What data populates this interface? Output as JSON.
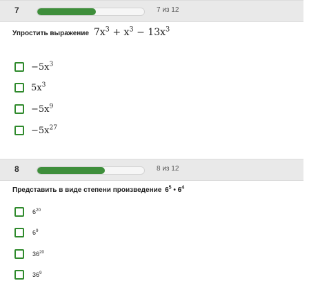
{
  "colors": {
    "accent": "#3e8e3b",
    "header_bg": "#e9e9e9",
    "checkbox_border": "#2f8a2c"
  },
  "questions": [
    {
      "number": "7",
      "progress": 0.55,
      "counter": "7 из 12",
      "prompt": "Упростить выражение",
      "expression": {
        "a": "7x",
        "a_exp": "3",
        "plus": "+",
        "b": "x",
        "b_exp": "3",
        "minus": "−",
        "c": "13x",
        "c_exp": "3"
      },
      "options": [
        {
          "base": "−5x",
          "exp": "3"
        },
        {
          "base": "5x",
          "exp": "3"
        },
        {
          "base": "−5x",
          "exp": "9"
        },
        {
          "base": "−5x",
          "exp": "27"
        }
      ]
    },
    {
      "number": "8",
      "progress": 0.63,
      "counter": "8 из 12",
      "prompt": "Представить в виде степени произведение",
      "expression": {
        "a": "6",
        "a_exp": "5",
        "dot": "•",
        "b": "6",
        "b_exp": "4"
      },
      "options": [
        {
          "base": "6",
          "exp": "20"
        },
        {
          "base": "6",
          "exp": "9"
        },
        {
          "base": "36",
          "exp": "20"
        },
        {
          "base": "36",
          "exp": "9"
        }
      ]
    }
  ]
}
